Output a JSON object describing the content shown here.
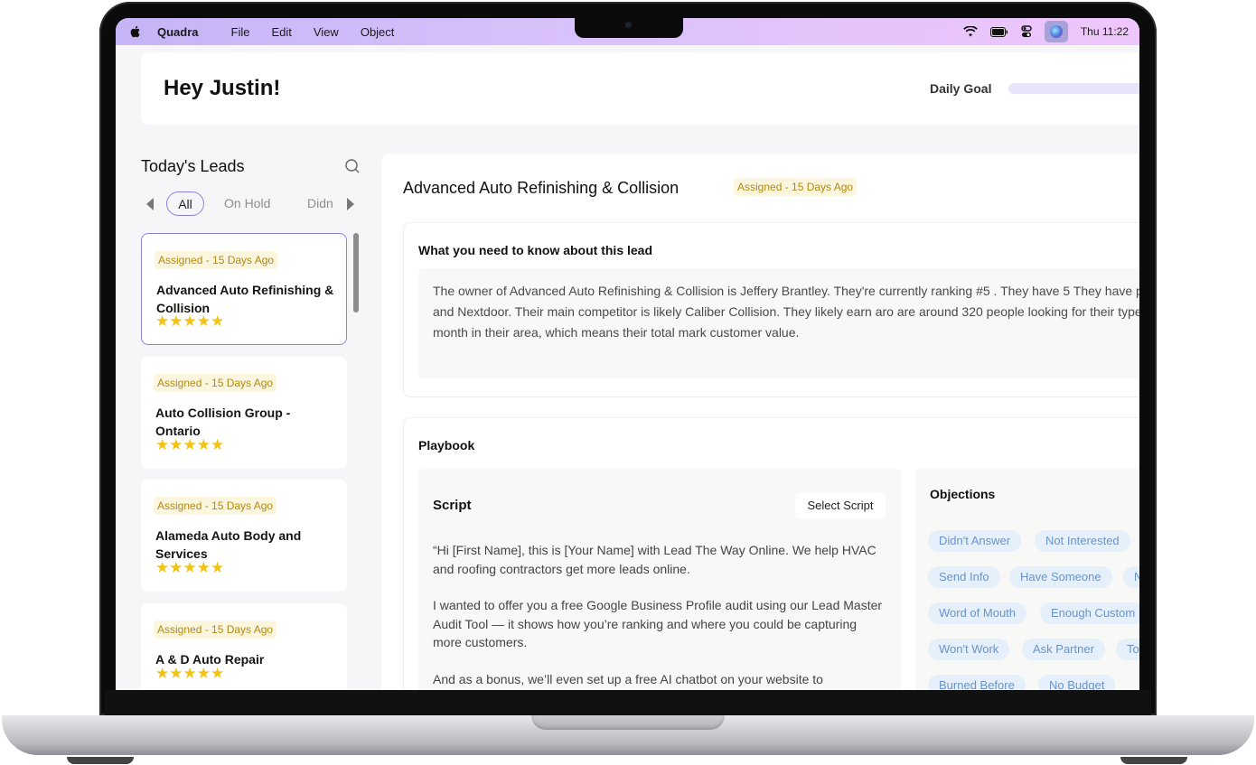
{
  "menubar": {
    "app_name": "Quadra",
    "menus": [
      "File",
      "Edit",
      "View",
      "Object"
    ],
    "time": "Thu 11:22"
  },
  "header": {
    "greeting": "Hey Justin!",
    "daily_goal_label": "Daily Goal"
  },
  "leads": {
    "title": "Today's Leads",
    "filters": [
      "All",
      "On Hold",
      "Didn"
    ],
    "selected_filter": "All",
    "items": [
      {
        "badge": "Assigned - 15 Days Ago",
        "name": "Advanced Auto Refinishing & Collision",
        "stars": "★★★★★",
        "rating": 5
      },
      {
        "badge": "Assigned - 15 Days Ago",
        "name": "Auto Collision Group - Ontario",
        "stars": "★★★★★",
        "rating": 5
      },
      {
        "badge": "Assigned - 15 Days Ago",
        "name": "Alameda Auto Body and Services",
        "stars": "★★★★★",
        "rating": 5
      },
      {
        "badge": "Assigned - 15 Days Ago",
        "name": "A & D Auto Repair",
        "stars": "★★★★★",
        "rating": 5
      }
    ]
  },
  "detail": {
    "title": "Advanced Auto Refinishing & Collision",
    "badge": "Assigned - 15 Days Ago",
    "know_title": "What you need to know about this lead",
    "know_text": "The owner of Advanced Auto Refinishing & Collision is Jeffery Brantley. They're currently ranking #5 . They have 5 They have profiles on google, and Nextdoor. Their main competitor is likely Caliber Collision. They likely earn aro are around 320 people looking for their type of business each month in their area, which means their total mark customer value.",
    "playbook_title": "Playbook",
    "script_title": "Script",
    "select_script_label": "Select Script",
    "script_paragraphs": [
      "“Hi [First Name], this is [Your Name] with Lead The Way Online. We help HVAC and roofing contractors get more leads online.",
      "I wanted to offer you a free Google Business Profile audit using our Lead Master Audit Tool — it shows how you’re ranking and where you could be capturing more customers.",
      "And as a bonus, we’ll even set up a free AI chatbot on your website to"
    ],
    "objections_title": "Objections",
    "objections": [
      "Didn't Answer",
      "Not Interested",
      "Send Info",
      "Have Someone",
      "N",
      "Word of Mouth",
      "Enough Custom",
      "Won't Work",
      "Ask Partner",
      "To",
      "Burned Before",
      "No Budget"
    ]
  },
  "colors": {
    "accent": "#8a82e0",
    "badge_bg": "#fdf6df",
    "badge_text": "#b08a12",
    "star": "#f2c314",
    "tag_bg": "#e6f0fb",
    "tag_text": "#6b93c7"
  }
}
